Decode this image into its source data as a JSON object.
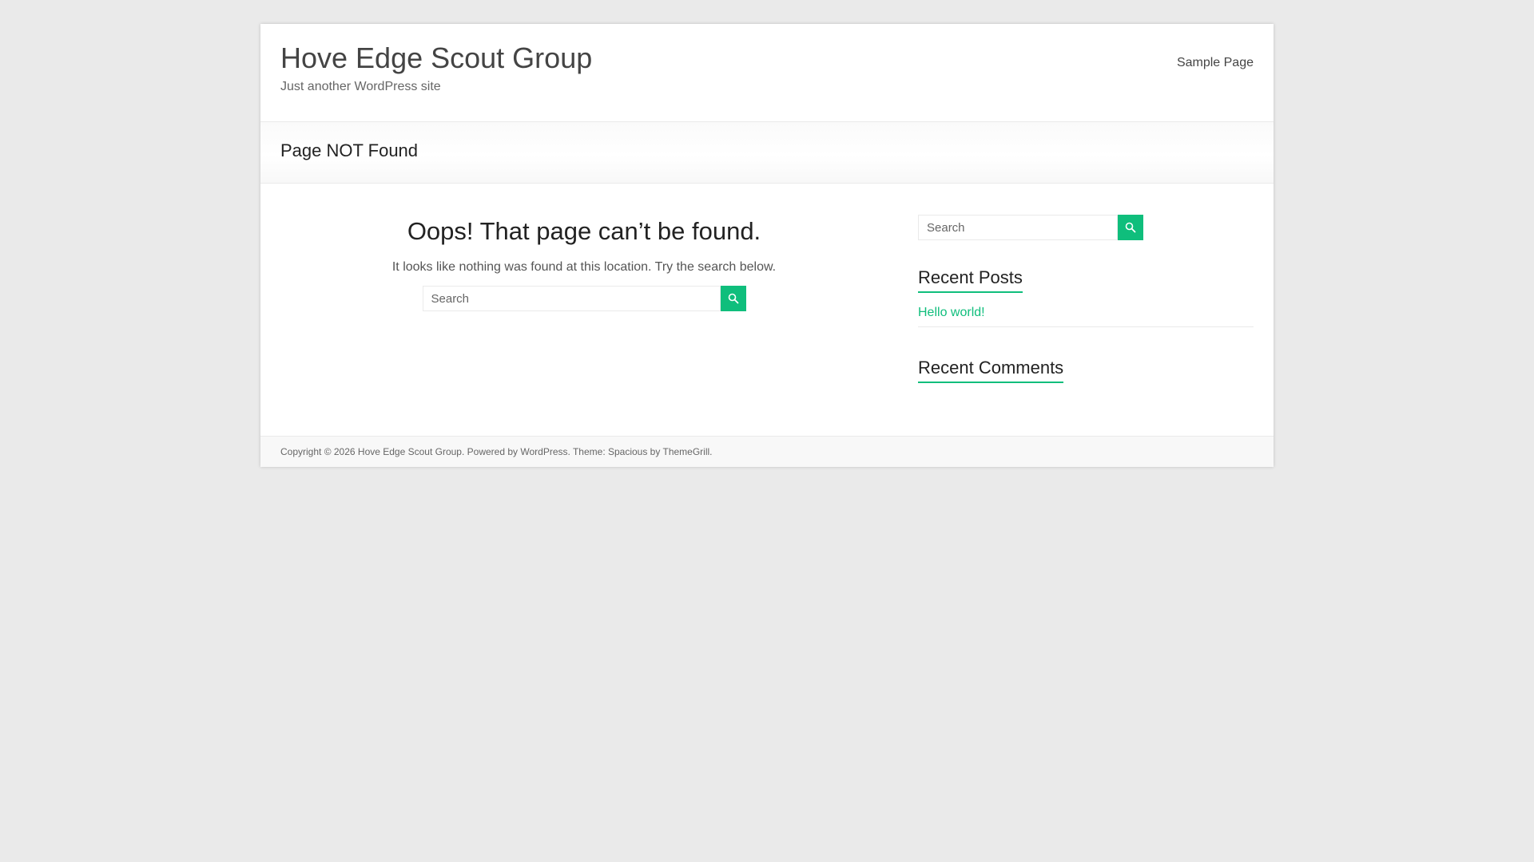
{
  "header": {
    "site_title": "Hove Edge Scout Group",
    "site_description": "Just another WordPress site",
    "nav": [
      "Sample Page"
    ]
  },
  "page_heading": "Page NOT Found",
  "main": {
    "error_title": "Oops! That page can’t be found.",
    "error_text": "It looks like nothing was found at this location. Try the search below.",
    "search_placeholder": "Search"
  },
  "sidebar": {
    "search_placeholder": "Search",
    "recent_posts_title": "Recent Posts",
    "recent_posts": [
      "Hello world!"
    ],
    "recent_comments_title": "Recent Comments"
  },
  "footer": {
    "copyright_prefix": "Copyright © 2026",
    "site_link": "Hove Edge Scout Group",
    "powered_prefix": ". Powered by",
    "wordpress_link": "WordPress",
    "theme_prefix": ". Theme: Spacious by",
    "themegrill_link": "ThemeGrill",
    "suffix": "."
  },
  "icons": {
    "search": "search-icon"
  },
  "colors": {
    "accent": "#0fbe7c",
    "background": "#eaeaea"
  }
}
